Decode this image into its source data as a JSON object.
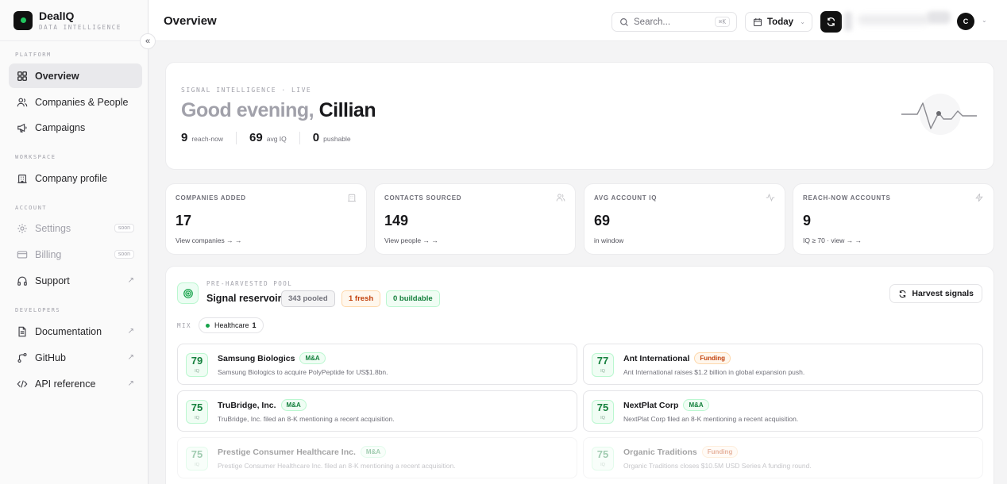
{
  "app": {
    "name": "DealIQ",
    "tagline": "DATA INTELLIGENCE",
    "collapse_glyph": "«"
  },
  "sidebar": {
    "sections": {
      "platform": "PLATFORM",
      "workspace": "WORKSPACE",
      "account": "ACCOUNT",
      "developers": "DEVELOPERS"
    },
    "items": [
      {
        "label": "Overview",
        "icon": "grid-icon",
        "active": true
      },
      {
        "label": "Companies & People",
        "icon": "users-icon"
      },
      {
        "label": "Campaigns",
        "icon": "megaphone-icon"
      },
      {
        "label": "Company profile",
        "icon": "building-icon"
      },
      {
        "label": "Settings",
        "icon": "gear-icon",
        "badge": "soon"
      },
      {
        "label": "Billing",
        "icon": "card-icon",
        "badge": "soon"
      },
      {
        "label": "Support",
        "icon": "headphones-icon",
        "external": "↗"
      },
      {
        "label": "Documentation",
        "icon": "document-icon",
        "external": "↗"
      },
      {
        "label": "GitHub",
        "icon": "git-icon",
        "external": "↗"
      },
      {
        "label": "API reference",
        "icon": "code-icon",
        "external": "↗"
      }
    ]
  },
  "topbar": {
    "title": "Overview",
    "search_placeholder": "Search...",
    "search_shortcut": "⌘K",
    "date_range": "Today",
    "avatar_initial": "C"
  },
  "hero": {
    "kicker": "SIGNAL INTELLIGENCE · LIVE",
    "greeting": "Good evening,",
    "name": "Cillian",
    "stats": [
      {
        "value": "9",
        "label": "reach-now"
      },
      {
        "value": "69",
        "label": "avg IQ"
      },
      {
        "value": "0",
        "label": "pushable"
      }
    ]
  },
  "kpis": [
    {
      "label": "COMPANIES ADDED",
      "value": "17",
      "sub": "View companies → →",
      "icon": "building-icon"
    },
    {
      "label": "CONTACTS SOURCED",
      "value": "149",
      "sub": "View people → →",
      "icon": "users-icon"
    },
    {
      "label": "AVG ACCOUNT IQ",
      "value": "69",
      "sub": "in window",
      "icon": "activity-icon"
    },
    {
      "label": "REACH-NOW ACCOUNTS",
      "value": "9",
      "sub": "IQ ≥ 70 · view → →",
      "icon": "bolt-icon"
    }
  ],
  "pool": {
    "kicker": "PRE-HARVESTED POOL",
    "title": "Signal reservoir",
    "pills": {
      "pooled": "343 pooled",
      "fresh": "1 fresh",
      "buildable": "0 buildable"
    },
    "harvest_label": "Harvest signals",
    "mix_label": "MIX",
    "mix_chip": {
      "name": "Healthcare",
      "count": "1"
    },
    "iq_unit": "IQ",
    "signals": [
      {
        "score": "79",
        "company": "Samsung Biologics",
        "tag": "M&A",
        "desc": "Samsung Biologics to acquire PolyPeptide for US$1.8bn."
      },
      {
        "score": "77",
        "company": "Ant International",
        "tag": "Funding",
        "desc": "Ant International raises $1.2 billion in global expansion push."
      },
      {
        "score": "75",
        "company": "TruBridge, Inc.",
        "tag": "M&A",
        "desc": "TruBridge, Inc. filed an 8-K mentioning a recent acquisition."
      },
      {
        "score": "75",
        "company": "NextPlat Corp",
        "tag": "M&A",
        "desc": "NextPlat Corp filed an 8-K mentioning a recent acquisition."
      },
      {
        "score": "75",
        "company": "Prestige Consumer Healthcare Inc.",
        "tag": "M&A",
        "desc": "Prestige Consumer Healthcare Inc. filed an 8-K mentioning a recent acquisition."
      },
      {
        "score": "75",
        "company": "Organic Traditions",
        "tag": "Funding",
        "desc": "Organic Traditions closes $10.5M USD Series A funding round."
      }
    ]
  }
}
